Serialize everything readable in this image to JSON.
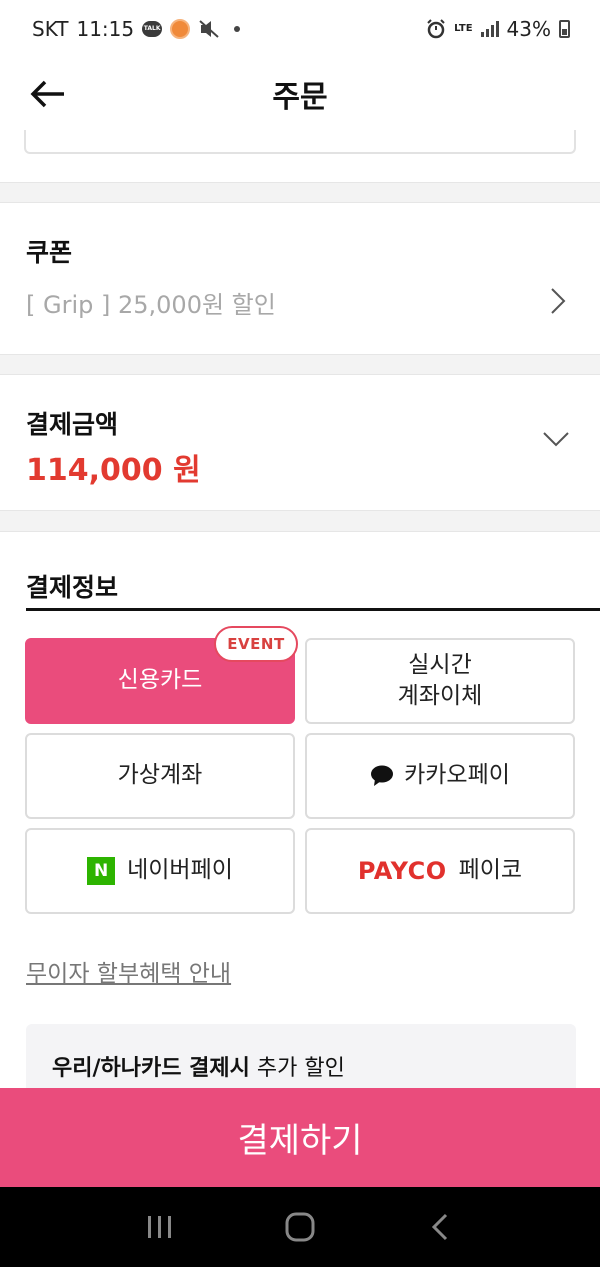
{
  "status_bar": {
    "carrier": "SKT",
    "time": "11:15",
    "talk_icon_text": "TALK",
    "network": "LTE",
    "battery": "43%",
    "icons": [
      "kakaotalk-icon",
      "notification-icon",
      "mute-icon",
      "alarm-icon",
      "signal-icon",
      "battery-icon"
    ]
  },
  "header": {
    "title": "주문",
    "back_icon": "arrow-left-icon"
  },
  "coupon": {
    "title": "쿠폰",
    "value": "[ Grip ] 25,000원 할인"
  },
  "payment_amount": {
    "title": "결제금액",
    "value": "114,000 원",
    "value_color": "#e23a30"
  },
  "payment_info": {
    "title": "결제정보",
    "event_badge": "EVENT",
    "methods": [
      {
        "label": "신용카드",
        "selected": true
      },
      {
        "label_line1": "실시간",
        "label_line2": "계좌이체",
        "selected": false
      },
      {
        "label": "가상계좌",
        "selected": false
      },
      {
        "label": "카카오페이",
        "icon": "kakao-bubble-icon",
        "selected": false
      },
      {
        "label": "네이버페이",
        "icon_text": "N",
        "selected": false
      },
      {
        "label": "페이코",
        "logo_text": "PAYCO",
        "selected": false
      }
    ],
    "installment_link": "무이자 할부혜택 안내",
    "promo_bold": "우리/하나카드 결제시",
    "promo_rest": " 추가 할인"
  },
  "submit": {
    "label": "결제하기"
  },
  "colors": {
    "accent": "#ea4c7c",
    "price_red": "#e23a30",
    "naver_green": "#2db400",
    "payco_red": "#e1312d"
  }
}
